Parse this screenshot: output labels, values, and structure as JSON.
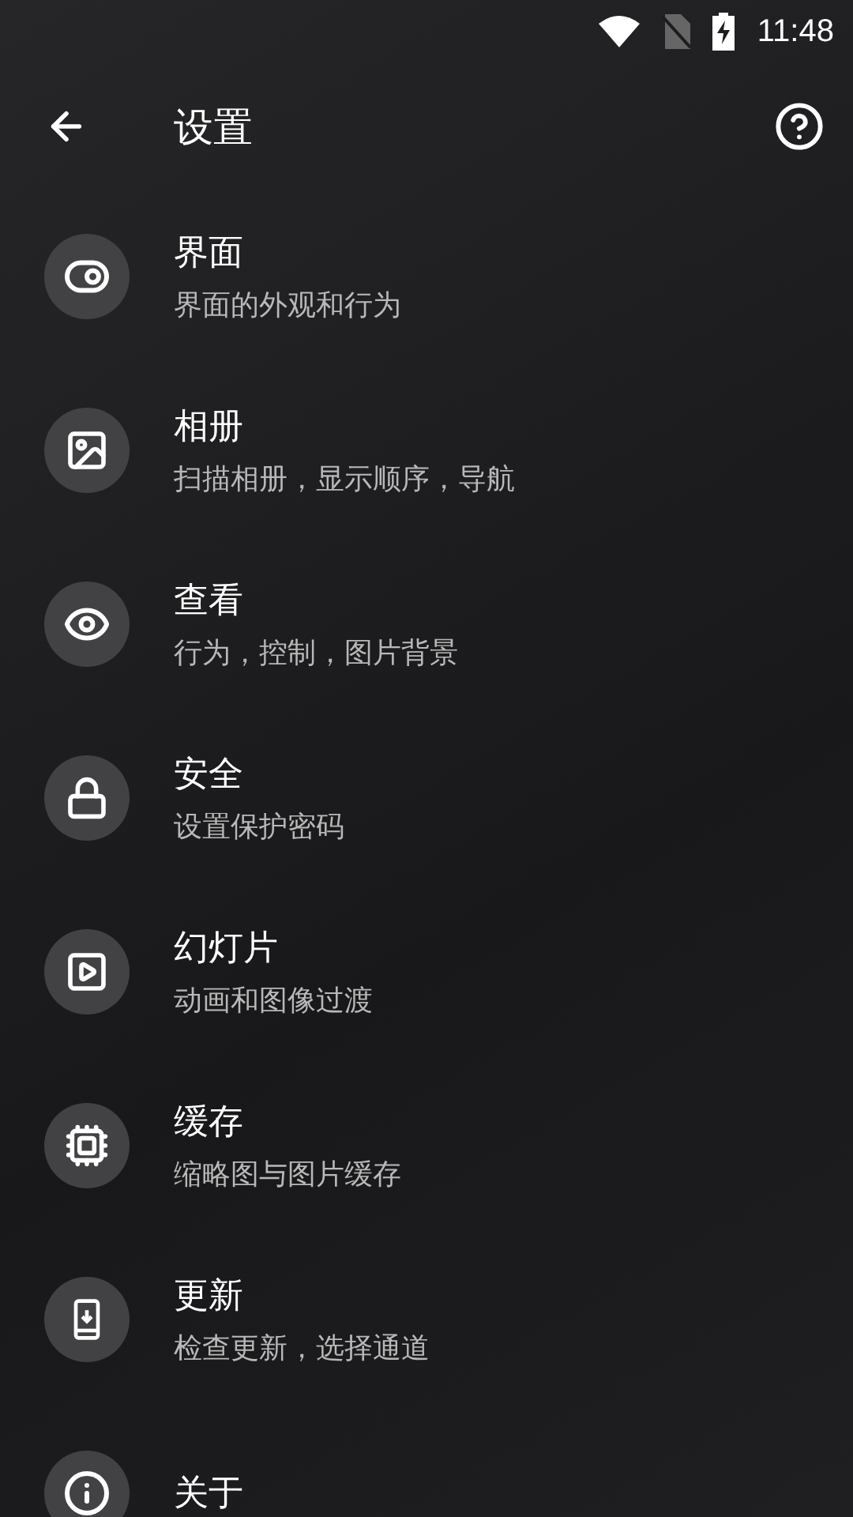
{
  "status_bar": {
    "time": "11:48"
  },
  "app_bar": {
    "title": "设置"
  },
  "items": [
    {
      "title": "界面",
      "subtitle": "界面的外观和行为"
    },
    {
      "title": "相册",
      "subtitle": "扫描相册，显示顺序，导航"
    },
    {
      "title": "查看",
      "subtitle": "行为，控制，图片背景"
    },
    {
      "title": "安全",
      "subtitle": "设置保护密码"
    },
    {
      "title": "幻灯片",
      "subtitle": "动画和图像过渡"
    },
    {
      "title": "缓存",
      "subtitle": "缩略图与图片缓存"
    },
    {
      "title": "更新",
      "subtitle": "检查更新，选择通道"
    },
    {
      "title": "关于"
    }
  ]
}
